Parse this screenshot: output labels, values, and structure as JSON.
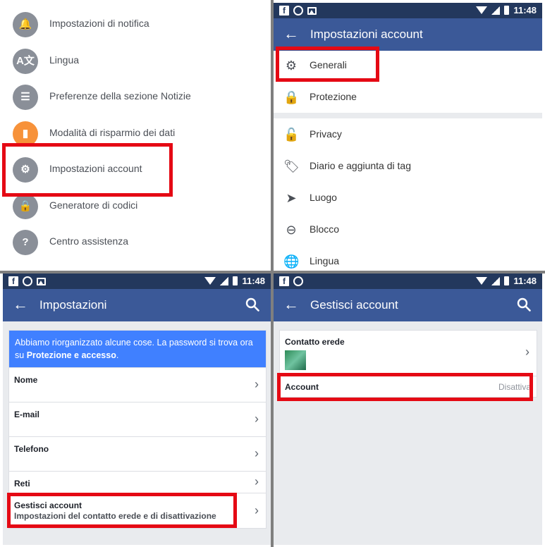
{
  "panel1": {
    "items": [
      {
        "label": "Impostazioni di notifica",
        "icon": "bell-icon",
        "glyph": "🔔",
        "color": "#8a8f98"
      },
      {
        "label": "Lingua",
        "icon": "translate-icon",
        "glyph": "A文",
        "color": "#8a8f98"
      },
      {
        "label": "Preferenze della sezione Notizie",
        "icon": "news-feed-icon",
        "glyph": "☰",
        "color": "#8a8f98"
      },
      {
        "label": "Modalità di risparmio dei dati",
        "icon": "data-saver-icon",
        "glyph": "▮",
        "color": "#f7923a"
      },
      {
        "label": "Impostazioni account",
        "icon": "account-settings-icon",
        "glyph": "⚙",
        "color": "#8a8f98"
      },
      {
        "label": "Generatore di codici",
        "icon": "code-generator-icon",
        "glyph": "🔒",
        "color": "#8a8f98"
      },
      {
        "label": "Centro assistenza",
        "icon": "help-center-icon",
        "glyph": "?",
        "color": "#8a8f98"
      }
    ]
  },
  "panel2": {
    "status_time": "11:48",
    "title": "Impostazioni account",
    "items": [
      {
        "label": "Generali",
        "icon": "gear-icon",
        "glyph": "⚙"
      },
      {
        "label": "Protezione",
        "icon": "lock-icon",
        "glyph": "🔒"
      },
      {
        "label": "Privacy",
        "icon": "privacy-lock-icon",
        "glyph": "🔓"
      },
      {
        "label": "Diario e aggiunta di tag",
        "icon": "tag-icon",
        "glyph": "🏷"
      },
      {
        "label": "Luogo",
        "icon": "location-arrow-icon",
        "glyph": "➤"
      },
      {
        "label": "Blocco",
        "icon": "block-icon",
        "glyph": "⊖"
      },
      {
        "label": "Lingua",
        "icon": "globe-icon",
        "glyph": "🌐"
      }
    ]
  },
  "panel3": {
    "status_time": "11:48",
    "title": "Impostazioni",
    "notice_text": "Abbiamo riorganizzato alcune cose. La password si trova ora su ",
    "notice_bold": "Protezione e accesso",
    "notice_end": ".",
    "rows": [
      {
        "label": "Nome",
        "sub": ""
      },
      {
        "label": "E-mail",
        "sub": ""
      },
      {
        "label": "Telefono",
        "sub": ""
      },
      {
        "label": "Reti",
        "sub": ""
      },
      {
        "label": "Gestisci account",
        "sub": "Impostazioni del contatto erede e di disattivazione"
      }
    ]
  },
  "panel4": {
    "status_time": "11:48",
    "title": "Gestisci account",
    "legacy_contact_label": "Contatto erede",
    "account_label": "Account",
    "account_value": "Disattiva"
  },
  "colors": {
    "facebook_blue": "#3b5998",
    "status_bar": "#23385d",
    "highlight_red": "#e50914",
    "notice_blue": "#4080ff"
  }
}
